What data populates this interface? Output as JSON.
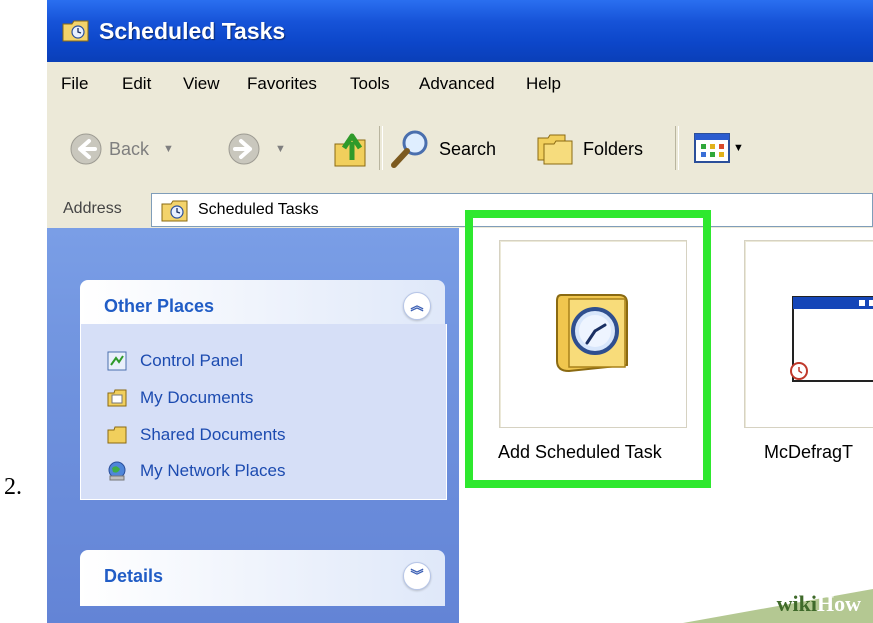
{
  "step_number": "2.",
  "window": {
    "title": "Scheduled Tasks"
  },
  "menu": [
    "File",
    "Edit",
    "View",
    "Favorites",
    "Tools",
    "Advanced",
    "Help"
  ],
  "toolbar": {
    "back_label": "Back",
    "search_label": "Search",
    "folders_label": "Folders"
  },
  "address": {
    "label": "Address",
    "value": "Scheduled Tasks"
  },
  "sidebar": {
    "other_places": {
      "title": "Other Places",
      "items": [
        {
          "label": "Control Panel",
          "icon": "control-panel-icon"
        },
        {
          "label": "My Documents",
          "icon": "my-documents-icon"
        },
        {
          "label": "Shared Documents",
          "icon": "shared-folder-icon"
        },
        {
          "label": "My Network Places",
          "icon": "network-places-icon"
        }
      ]
    },
    "details": {
      "title": "Details"
    }
  },
  "files": [
    {
      "label": "Add Scheduled Task",
      "icon": "add-scheduled-task-icon",
      "highlighted": true
    },
    {
      "label": "McDefragT",
      "icon": "scheduled-task-window-icon",
      "highlighted": false
    }
  ],
  "watermark": {
    "wiki": "wiki",
    "how": "How"
  },
  "colors": {
    "highlight": "#2ee82e",
    "titlebar": "#0c46c9",
    "sidebar": "#6f92de",
    "link": "#1c4bb0"
  }
}
